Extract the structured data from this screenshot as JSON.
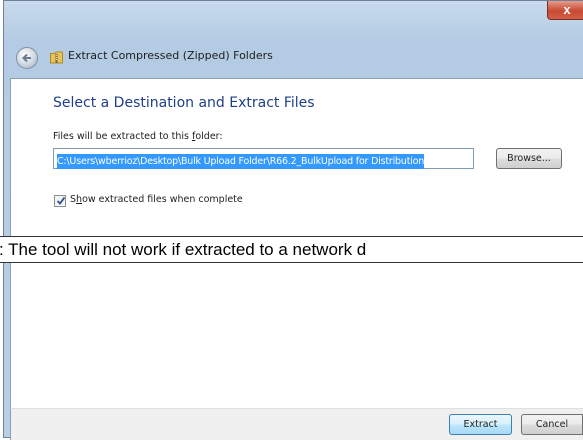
{
  "window": {
    "close_label": "x",
    "title": "Extract Compressed (Zipped) Folders"
  },
  "content": {
    "heading": "Select a Destination and Extract Files",
    "field_label_pre": "Files will be extracted to this ",
    "field_label_u": "f",
    "field_label_post": "older:",
    "path_value": "C:\\Users\\wberrioz\\Desktop\\Bulk Upload Folder\\R66.2_BulkUpload for Distribution",
    "browse_label": "Browse...",
    "checkbox_checked": true,
    "checkbox_label_pre": "S",
    "checkbox_label_u": "h",
    "checkbox_label_post": "ow extracted files when complete"
  },
  "note": {
    "text": ": The tool will not work if extracted to a network d"
  },
  "footer": {
    "extract_label": "Extract",
    "cancel_label": "Cancel"
  },
  "colors": {
    "heading": "#1e3f8a",
    "selection": "#3399ff",
    "close_button": "#c74a33"
  }
}
